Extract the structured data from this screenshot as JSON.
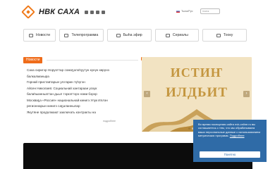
{
  "header": {
    "logo_text": "НВК САХА",
    "language": "Тыла/Рус",
    "search_placeholder": "поиск"
  },
  "nav": {
    "items": [
      {
        "label": "Новости",
        "icon": "news-icon"
      },
      {
        "label": "Телепрограмма",
        "icon": "tv-program-icon"
      },
      {
        "label": "Быһа эфир",
        "icon": "live-icon"
      },
      {
        "label": "Сериалы",
        "icon": "series-icon"
      },
      {
        "label": "Тооку",
        "icon": "tooku-icon"
      }
    ]
  },
  "news": {
    "label": "Новости",
    "items": [
      "Саха сиригэр Норуоттар сомоҕолоһуутун күнүн көрүнэ",
      "балкалманыра",
      "Горнай приставтарын улэ'арин түһүгэн",
      "Айсен Николаев: Социальнай хантараан ускук",
      "балаһыанньаттан дьыл тэркэттэрэ нэми бэрэр",
      "Москваҕа «Россия» национальнай кинигэ Улук Иллэн",
      "регионнарын кинигэ саҕаланнылар",
      "Якутяне продолжают заключать контракты на"
    ],
    "more": "подробнее"
  },
  "banner": {
    "line1": "ИСТИҤ",
    "line2": "ИЛДЬИТ"
  },
  "cookie": {
    "text": "Во время посещения сайта nvk-online.ru вы соглашаетесь с тем, что мы обрабатываем ваши персональные данные с использованием метрических программ.",
    "link": "Подробнее",
    "button": "Понятно"
  },
  "colors": {
    "accent": "#ef6c1a",
    "cookie_bg": "#2f6ba7",
    "banner_bg": "#f2e3c2",
    "banner_text": "#c4963f"
  }
}
